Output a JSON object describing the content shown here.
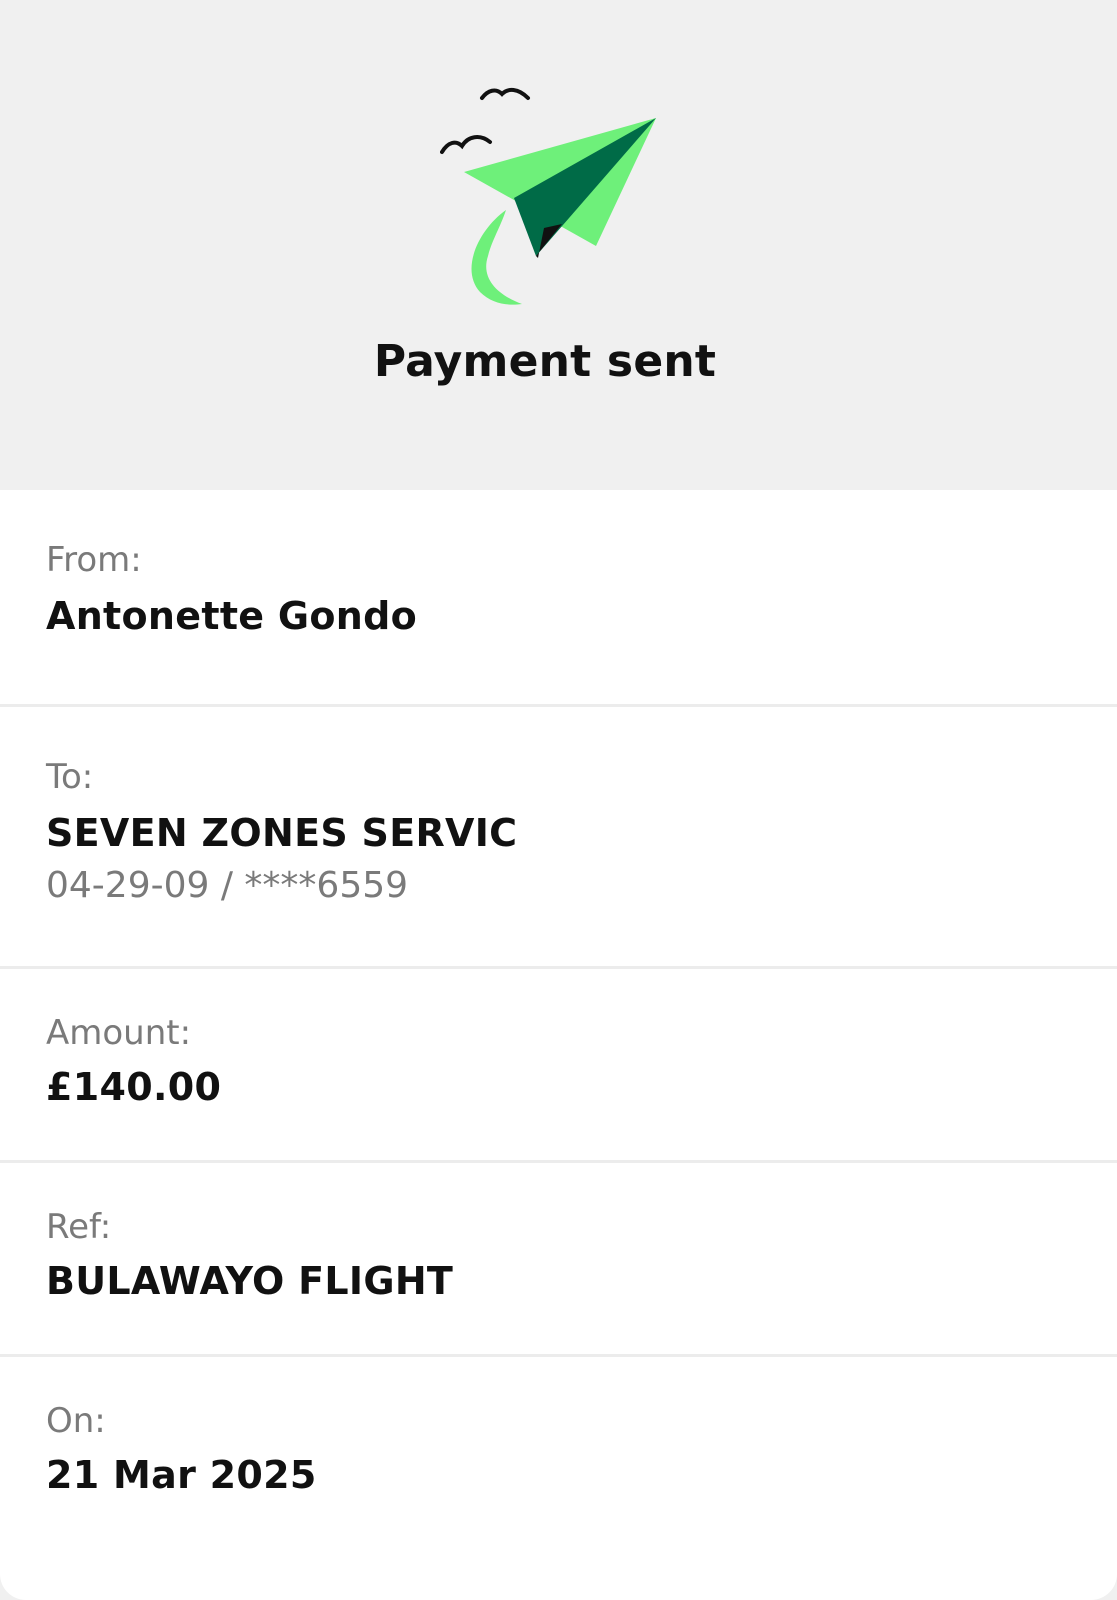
{
  "header": {
    "title": "Payment sent",
    "icon": "paper-plane-icon",
    "colors": {
      "background": "#f0f0f0",
      "plane_light": "#6ef07a",
      "plane_dark": "#006b47"
    }
  },
  "details": {
    "from": {
      "label": "From:",
      "value": "Antonette Gondo"
    },
    "to": {
      "label": "To:",
      "value": "SEVEN ZONES SERVIC",
      "account": "04-29-09 / ****6559"
    },
    "amount": {
      "label": "Amount:",
      "value": "£140.00"
    },
    "ref": {
      "label": "Ref:",
      "value": "BULAWAYO FLIGHT"
    },
    "on": {
      "label": "On:",
      "value": "21 Mar 2025"
    }
  }
}
